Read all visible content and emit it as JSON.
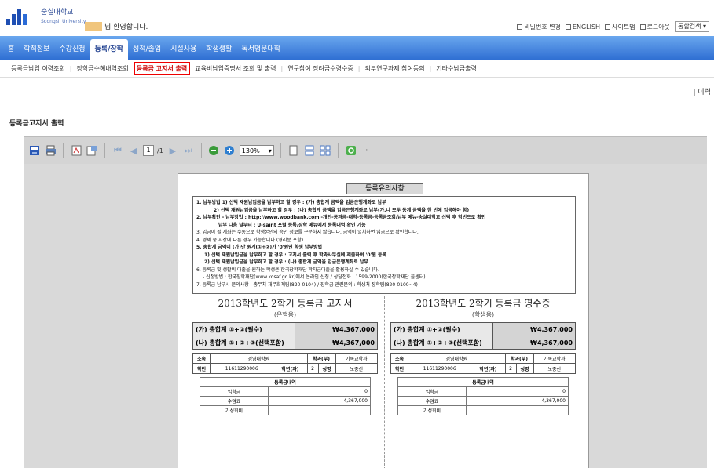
{
  "header": {
    "university_name": "숭실대학교",
    "university_name_en": "Soongsil University",
    "welcome_text": "님 환영합니다.",
    "top_links": [
      "비밀번호 변경",
      "ENGLISH",
      "사이트맵",
      "로그아웃"
    ],
    "search_dropdown": "통합검색"
  },
  "nav": {
    "items": [
      "홈",
      "학적정보",
      "수강신청",
      "등록/장학",
      "성적/졸업",
      "시설사용",
      "학생생활",
      "독서명문대학"
    ],
    "active_index": 3
  },
  "subnav": {
    "items": [
      "등록금납입 이력조회",
      "장학금수혜내역조회",
      "등록금 고지서 출력",
      "교육비납입증명서 조회 및 출력",
      "연구참여 장려금수령수증",
      "외부연구과제 참여동의",
      "기타수납금출력"
    ],
    "active_index": 2
  },
  "right_tag": "| 이력",
  "page_title": "등록금고지서 출력",
  "viewer": {
    "page_current": "1",
    "page_total": "/1",
    "zoom": "130%"
  },
  "document": {
    "notice_title": "등록유의사항",
    "notice_lines": [
      "1. 납부방법 1) 선택 재원납입금을 납부하고 할 경우 : (가) 총합계 금액을 입금은행계좌로 납부",
      "2) 선택 재원납입금을 납부하고 할 경우 : (나) 총합계 금액을 입금은행계좌로 납부(가,나 모두 동계 금액을 한 번에 입금해야 함)",
      "2. 납부확인 - 납부방법 : http://www.woodbank.com -개인-공과금-대학-등록금-등록금조회/납부 메뉴-숭실대학교 선택 후 학번으로 확인",
      "납부 다음 날부터 : U-saint 포털 등록/장학 메뉴에서 등록내역 확인 가능",
      "3. 입금이 될 계좌는 수동으로 학생본인의 승인 정보를 구분하지 않습니다. 금액이 일치하면 입금으로 확인합니다.",
      "4. 경제 중 시장에 다른 경우 가능합니다 (영리분 포함)",
      "5. 총합계 금액이 (가)만 원계(①+②)가 '0'원인 학생 납부방법",
      "1) 선택 재원납입금을 납부하고 할 경우 : 고지서 출력 후 학과사무실에 제출하여 '0'원 등록",
      "2) 선택 재원납입금을 납부하고 할 경우 : (나) 총합계 금액을 입금은행계좌로 납부",
      "6. 등록금 및 생활비 대출을 원하는 학생은 한국장학재단 학자금대출을 활용하실 수 있습니다.",
      "- 신청방법 : 한국장학재단(www.kosaf.go.kr)에서 온라인 신청 / 상담전화 : 1599-2000(한국장학재단 콜센터)",
      "7. 등록금 납부시 문의사항 : 총무처 재무회계팀(820-0104) / 장학금 관련문의 : 학생처 장학팀(820-0100~4)"
    ],
    "left": {
      "title": "2013학년도 2학기 등록금 고지서",
      "sub": "(은행용)"
    },
    "right": {
      "title": "2013학년도 2학기 등록금 영수증",
      "sub": "(학생용)"
    },
    "amount_rows": [
      {
        "label": "(가) 총합계 ①+②(필수)",
        "value": "₩4,367,000"
      },
      {
        "label": "(나) 총합계 ①+②+③(선택포함)",
        "value": "₩4,367,000"
      }
    ],
    "info_row1": [
      "소속",
      "경영대학원",
      "학과(부)",
      "기독교학과"
    ],
    "info_row2": [
      "학번",
      "11611290006",
      "학년(과)",
      "2",
      "성명",
      "노중선"
    ],
    "detail_header": "등록금내역",
    "detail_rows": [
      {
        "label": "입학금",
        "value": "0"
      },
      {
        "label": "수업료",
        "value": "4,367,000"
      },
      {
        "label": "기성회비",
        "value": ""
      }
    ]
  }
}
